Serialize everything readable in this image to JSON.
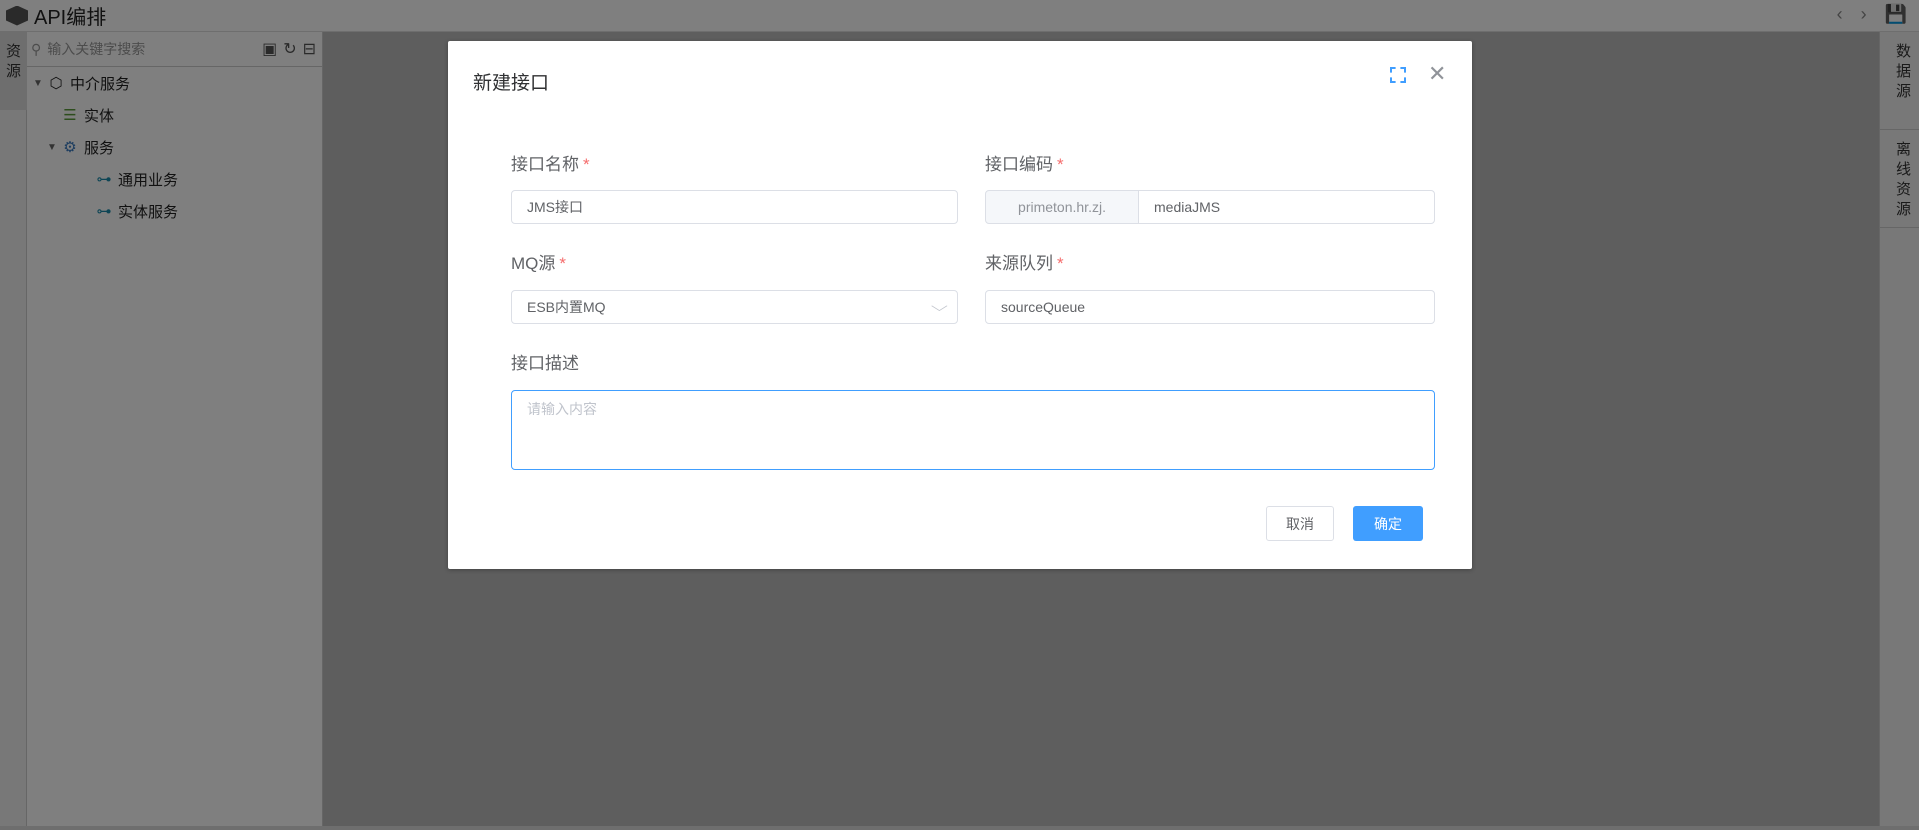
{
  "app": {
    "title": "API编排"
  },
  "left_tab": {
    "label": "资源"
  },
  "tree": {
    "search_placeholder": "输入关键字搜索",
    "nodes": [
      {
        "label": "中介服务"
      },
      {
        "label": "实体"
      },
      {
        "label": "服务"
      },
      {
        "label": "通用业务"
      },
      {
        "label": "实体服务"
      }
    ]
  },
  "right_tabs": [
    {
      "label": "数据源"
    },
    {
      "label": "离线资源"
    }
  ],
  "dialog": {
    "title": "新建接口",
    "fields": {
      "name": {
        "label": "接口名称",
        "value": "JMS接口",
        "required": "*"
      },
      "code": {
        "label": "接口编码",
        "prefix": "primeton.hr.zj.",
        "value": "mediaJMS",
        "required": "*"
      },
      "mq": {
        "label": "MQ源",
        "value": "ESB内置MQ",
        "required": "*"
      },
      "queue": {
        "label": "来源队列",
        "value": "sourceQueue",
        "required": "*"
      },
      "desc": {
        "label": "接口描述",
        "placeholder": "请输入内容"
      }
    },
    "cancel": "取消",
    "confirm": "确定"
  },
  "colors": {
    "primary": "#409eff",
    "required": "#f56c6c"
  }
}
